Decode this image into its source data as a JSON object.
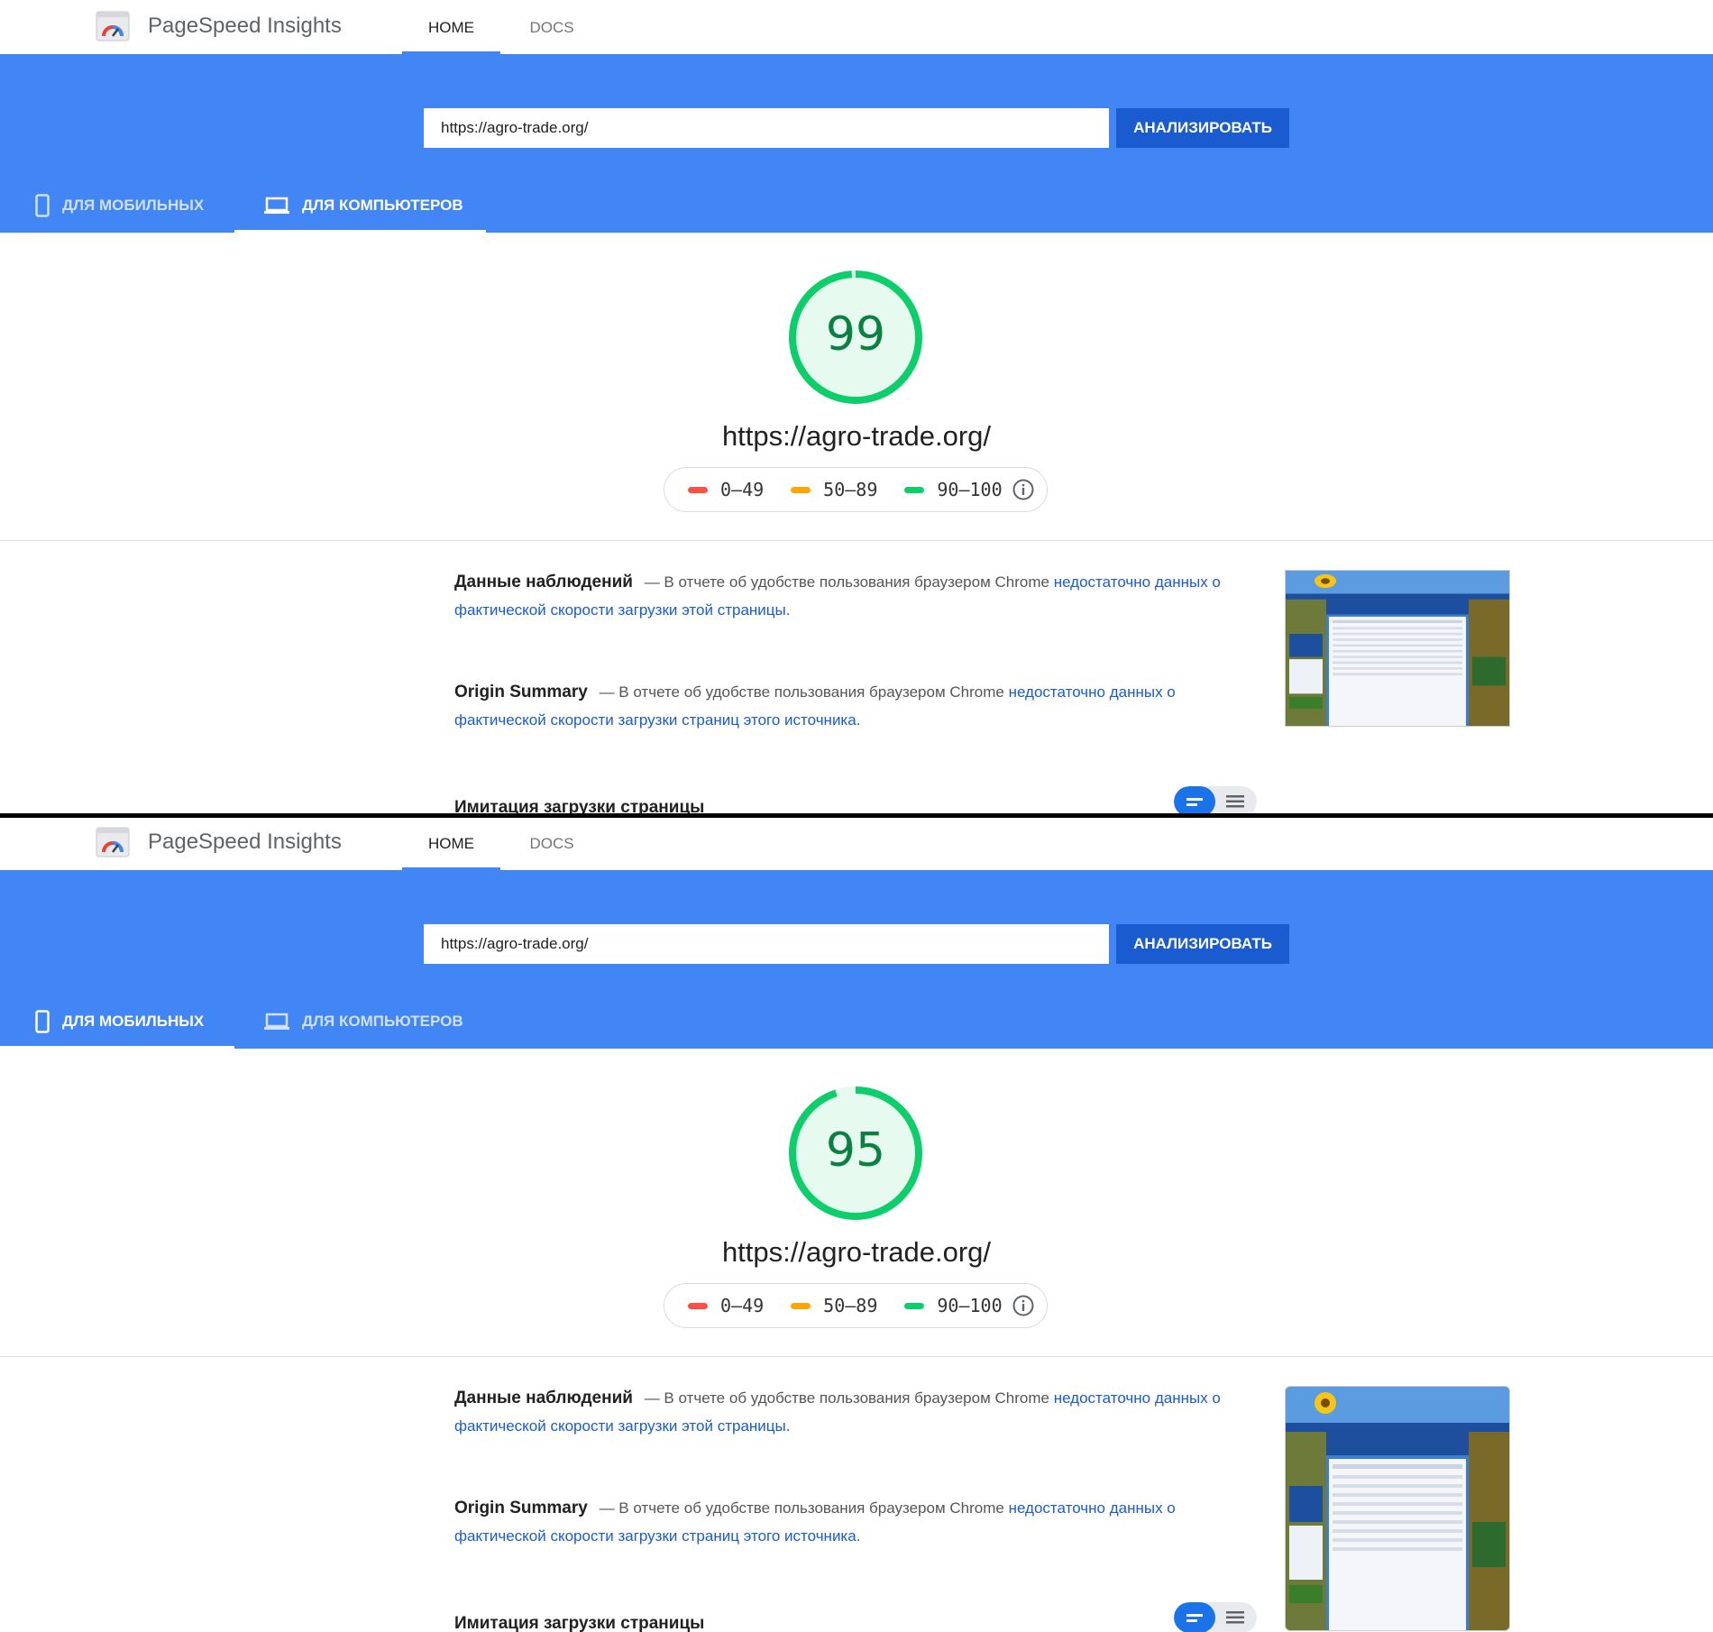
{
  "panels": [
    {
      "header": {
        "app_title": "PageSpeed Insights",
        "nav": {
          "home": "HOME",
          "docs": "DOCS"
        }
      },
      "search": {
        "value": "https://agro-trade.org/",
        "button": "АНАЛИЗИРОВАТЬ"
      },
      "device_tabs": {
        "mobile": "ДЛЯ МОБИЛЬНЫХ",
        "desktop": "ДЛЯ КОМПЬЮТЕРОВ",
        "active": "desktop"
      },
      "score": {
        "value": "99",
        "fraction": 0.99
      },
      "url": "https://agro-trade.org/",
      "legend": {
        "fail": "0–49",
        "average": "50–89",
        "pass": "90–100"
      },
      "field_data": {
        "title": "Данные наблюдений",
        "desc": "— В отчете об удобстве пользования браузером Chrome",
        "link": "недостаточно данных о фактической скорости загрузки этой страницы."
      },
      "origin_summary": {
        "title": "Origin Summary",
        "desc": "— В отчете об удобстве пользования браузером Chrome",
        "link": "недостаточно данных о фактической скорости загрузки страниц этого источника."
      },
      "lab_title": "Имитация загрузки страницы"
    },
    {
      "header": {
        "app_title": "PageSpeed Insights",
        "nav": {
          "home": "HOME",
          "docs": "DOCS"
        }
      },
      "search": {
        "value": "https://agro-trade.org/",
        "button": "АНАЛИЗИРОВАТЬ"
      },
      "device_tabs": {
        "mobile": "ДЛЯ МОБИЛЬНЫХ",
        "desktop": "ДЛЯ КОМПЬЮТЕРОВ",
        "active": "mobile"
      },
      "score": {
        "value": "95",
        "fraction": 0.95
      },
      "url": "https://agro-trade.org/",
      "legend": {
        "fail": "0–49",
        "average": "50–89",
        "pass": "90–100"
      },
      "field_data": {
        "title": "Данные наблюдений",
        "desc": "— В отчете об удобстве пользования браузером Chrome",
        "link": "недостаточно данных о фактической скорости загрузки этой страницы."
      },
      "origin_summary": {
        "title": "Origin Summary",
        "desc": "— В отчете об удобстве пользования браузером Chrome",
        "link": "недостаточно данных о фактической скорости загрузки страниц этого источника."
      },
      "lab_title": "Имитация загрузки страницы"
    }
  ],
  "colors": {
    "brand_blue": "#4285f4",
    "button_blue": "#1a5ccf",
    "pass_green": "#0cce6b",
    "pass_text": "#0b8043",
    "average_orange": "#ffa400",
    "fail_red": "#ff4e42"
  },
  "icons": [
    "pagespeed-logo-icon",
    "mobile-phone-icon",
    "laptop-icon",
    "info-icon",
    "card-view-icon",
    "list-view-icon"
  ]
}
